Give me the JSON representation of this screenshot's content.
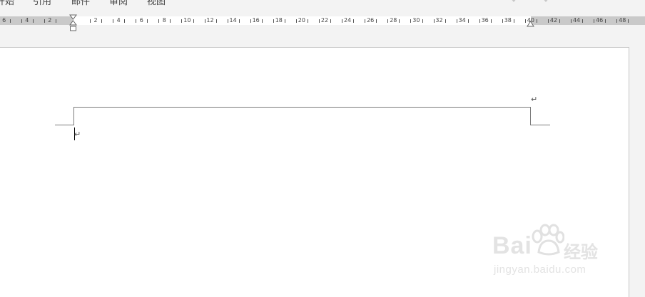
{
  "menu": {
    "items": [
      "开始",
      "引用",
      "邮件",
      "审阅",
      "视图"
    ]
  },
  "ruler": {
    "labels": [
      "6",
      "4",
      "2",
      "2",
      "4",
      "6",
      "8",
      "10",
      "12",
      "14",
      "16",
      "18",
      "20",
      "22",
      "24",
      "26",
      "28",
      "30",
      "32",
      "34",
      "36",
      "38",
      "40",
      "42",
      "44",
      "46",
      "48"
    ]
  },
  "document": {
    "paragraph_mark": "↵",
    "header_paragraph_mark": "↵"
  },
  "watermark": {
    "brand": "Bai",
    "brand_suffix": "经验",
    "url": "jingyan.baidu.com"
  }
}
